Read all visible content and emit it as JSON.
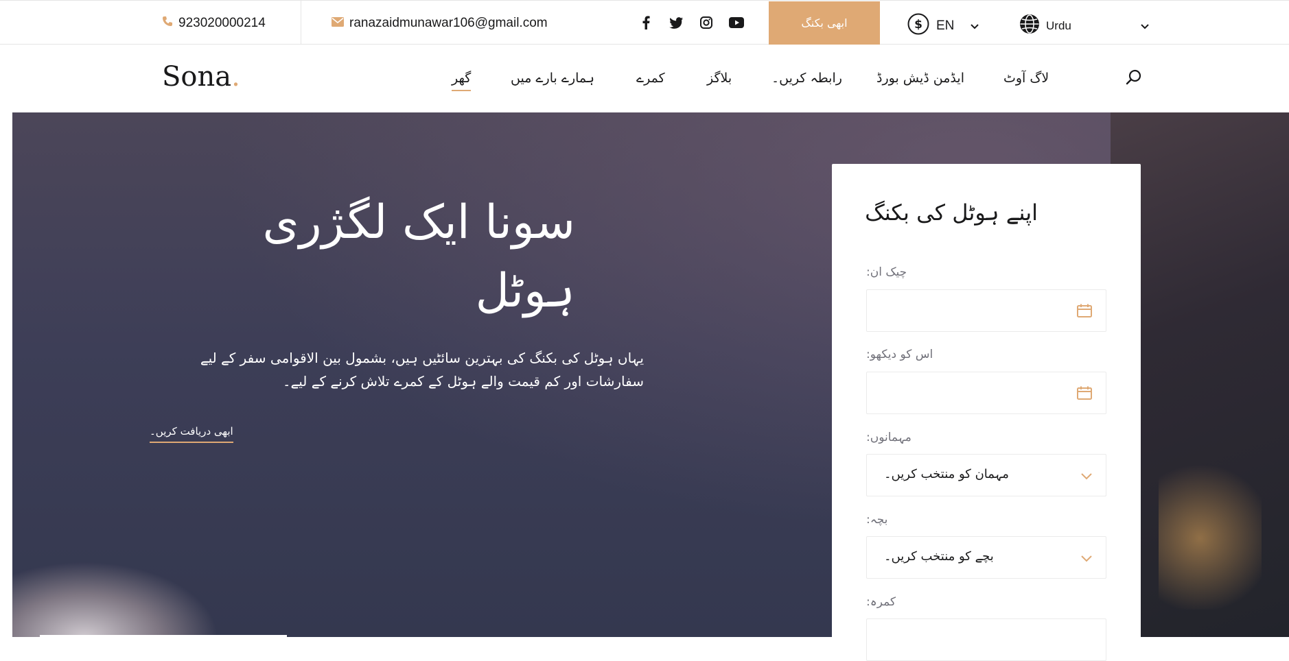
{
  "colors": {
    "accent": "#dfa974",
    "text": "#19191a",
    "muted": "#707079"
  },
  "topbar": {
    "phone": "923020000214",
    "email": "ranazaidmunawar106@gmail.com",
    "social_icons": [
      "facebook-icon",
      "twitter-icon",
      "instagram-icon",
      "youtube-icon"
    ],
    "book_label": "ابھی بکنگ",
    "currency_code": "EN",
    "language": "Urdu"
  },
  "header": {
    "logo_text": "Sona",
    "logo_dot": ".",
    "nav": {
      "home": "گھر",
      "about": "ہمارے بارے میں",
      "rooms": "کمرے",
      "blogs": "بلاگز",
      "contact": "رابطہ کریں۔",
      "admin": "ایڈمن ڈیش بورڈ",
      "logout": "لاگ آوٹ"
    }
  },
  "hero": {
    "title": "سونا ایک لگژری ہوٹل",
    "text": "یہاں ہوٹل کی بکنگ کی بہترین سائٹیں ہیں، بشمول بین الاقوامی سفر کے لیے سفارشات اور کم قیمت والے ہوٹل کے کمرے تلاش کرنے کے لیے۔",
    "link": "ابھی دریافت کریں۔"
  },
  "booking": {
    "title": "اپنے ہوٹل کی بکنگ",
    "checkin_label": "چیک ان:",
    "checkout_label": "اس کو دیکھو:",
    "guests_label": "مہمانوں:",
    "guests_value": "مہمان کو منتخب کریں۔",
    "children_label": "بچہ:",
    "children_value": "بچے کو منتخب کریں۔",
    "room_label": "کمرہ:"
  }
}
